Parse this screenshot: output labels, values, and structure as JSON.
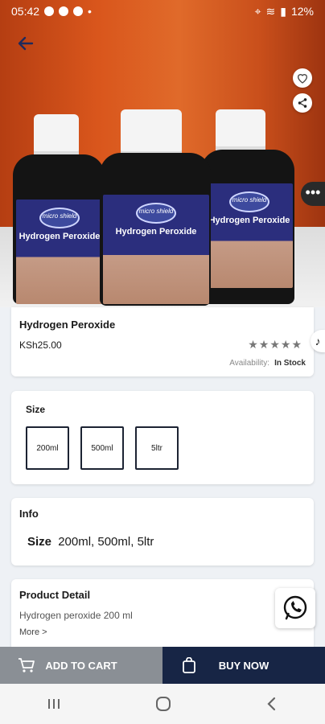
{
  "status_bar": {
    "time": "05:42",
    "battery": "12%"
  },
  "product": {
    "name": "Hydrogen Peroxide",
    "price": "KSh25.00",
    "rating_stars": "★★★★★",
    "availability_label": "Availability:",
    "availability_value": "In Stock",
    "bottle_brand": "micro shield",
    "bottle_label": "Hydrogen Peroxide"
  },
  "size_section": {
    "title": "Size",
    "options": [
      "200ml",
      "500ml",
      "5ltr"
    ]
  },
  "info_section": {
    "title": "Info",
    "size_label": "Size",
    "size_value": "200ml, 500ml, 5ltr"
  },
  "detail_section": {
    "title": "Product Detail",
    "description": "Hydrogen peroxide 200 ml",
    "more": "More >"
  },
  "actions": {
    "add_to_cart": "ADD TO CART",
    "buy_now": "BUY NOW"
  },
  "colors": {
    "buy_now_bg": "#172545",
    "add_to_cart_bg": "#8a8f95",
    "hero_orange": "#d9561c"
  },
  "icons": [
    "back-arrow-icon",
    "heart-icon",
    "share-icon",
    "more-dots-icon",
    "music-note-icon",
    "whatsapp-icon",
    "cart-icon",
    "bag-icon"
  ]
}
